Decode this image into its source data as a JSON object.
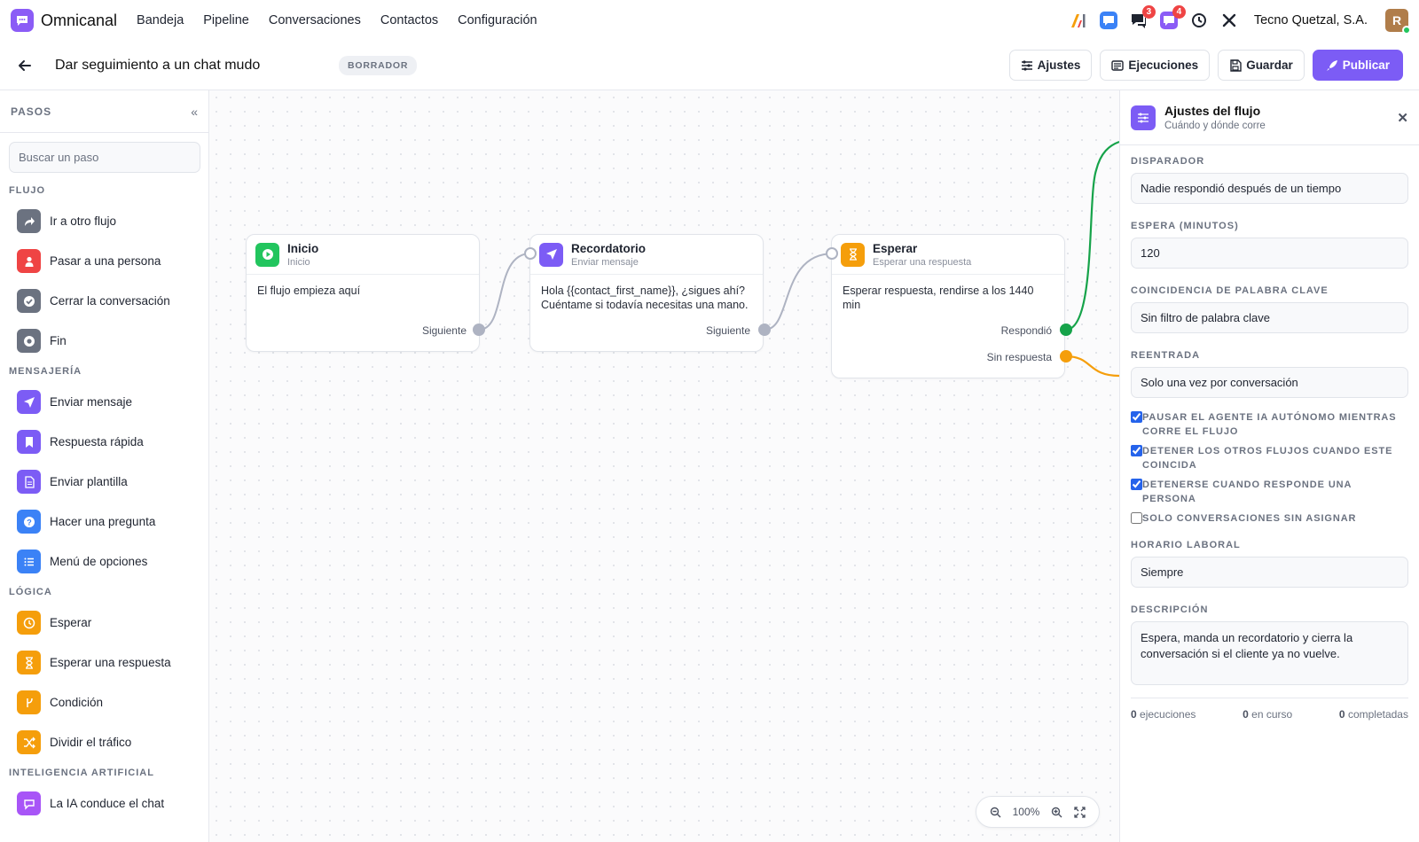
{
  "topnav": {
    "brand": "Omnicanal",
    "items": [
      "Bandeja",
      "Pipeline",
      "Conversaciones",
      "Contactos",
      "Configuración"
    ],
    "notif_chat_count": "3",
    "notif_inbox_count": "4",
    "company": "Tecno Quetzal, S.A.",
    "avatar_initial": "R"
  },
  "flow": {
    "title": "Dar seguimiento a un chat mudo",
    "status": "BORRADOR",
    "actions": {
      "settings": "Ajustes",
      "runs": "Ejecuciones",
      "save": "Guardar",
      "publish": "Publicar"
    }
  },
  "steps_panel": {
    "title": "PASOS",
    "search_placeholder": "Buscar un paso",
    "sections": [
      {
        "title": "FLUJO",
        "items": [
          "Ir a otro flujo",
          "Pasar a una persona",
          "Cerrar la conversación",
          "Fin"
        ]
      },
      {
        "title": "MENSAJERÍA",
        "items": [
          "Enviar mensaje",
          "Respuesta rápida",
          "Enviar plantilla",
          "Hacer una pregunta",
          "Menú de opciones"
        ]
      },
      {
        "title": "LÓGICA",
        "items": [
          "Esperar",
          "Esperar una respuesta",
          "Condición",
          "Dividir el tráfico"
        ]
      },
      {
        "title": "INTELIGENCIA ARTIFICIAL",
        "items": [
          "La IA conduce el chat"
        ]
      }
    ]
  },
  "canvas": {
    "nodes": [
      {
        "title": "Inicio",
        "subtitle": "Inicio",
        "body": "El flujo empieza aquí",
        "ports": [
          "Siguiente"
        ]
      },
      {
        "title": "Recordatorio",
        "subtitle": "Enviar mensaje",
        "body": "Hola {{contact_first_name}}, ¿sigues ahí? Cuéntame si todavía necesitas una mano.",
        "ports": [
          "Siguiente"
        ]
      },
      {
        "title": "Esperar",
        "subtitle": "Esperar una respuesta",
        "body": "Esperar respuesta, rendirse a los 1440 min",
        "ports": [
          "Respondió",
          "Sin respuesta"
        ]
      }
    ],
    "zoom": "100%"
  },
  "settings_panel": {
    "title": "Ajustes del flujo",
    "subtitle": "Cuándo y dónde corre",
    "trigger_label": "DISPARADOR",
    "trigger_value": "Nadie respondió después de un tiempo",
    "wait_label": "ESPERA (MINUTOS)",
    "wait_value": "120",
    "keyword_label": "COINCIDENCIA DE PALABRA CLAVE",
    "keyword_value": "Sin filtro de palabra clave",
    "reentry_label": "REENTRADA",
    "reentry_value": "Solo una vez por conversación",
    "checks": [
      {
        "label": "PAUSAR EL AGENTE IA AUTÓNOMO MIENTRAS CORRE EL FLUJO",
        "checked": true
      },
      {
        "label": "DETENER LOS OTROS FLUJOS CUANDO ESTE COINCIDA",
        "checked": true
      },
      {
        "label": "DETENERSE CUANDO RESPONDE UNA PERSONA",
        "checked": true
      },
      {
        "label": "SOLO CONVERSACIONES SIN ASIGNAR",
        "checked": false
      }
    ],
    "hours_label": "HORARIO LABORAL",
    "hours_value": "Siempre",
    "description_label": "DESCRIPCIÓN",
    "description_value": "Espera, manda un recordatorio y cierra la conversación si el cliente ya no vuelve.",
    "stats": [
      {
        "count": "0",
        "label": "ejecuciones"
      },
      {
        "count": "0",
        "label": "en curso"
      },
      {
        "count": "0",
        "label": "completadas"
      }
    ]
  },
  "colors": {
    "accent": "#7c5cf5",
    "success": "#16a34a",
    "warning": "#f59e0b"
  }
}
